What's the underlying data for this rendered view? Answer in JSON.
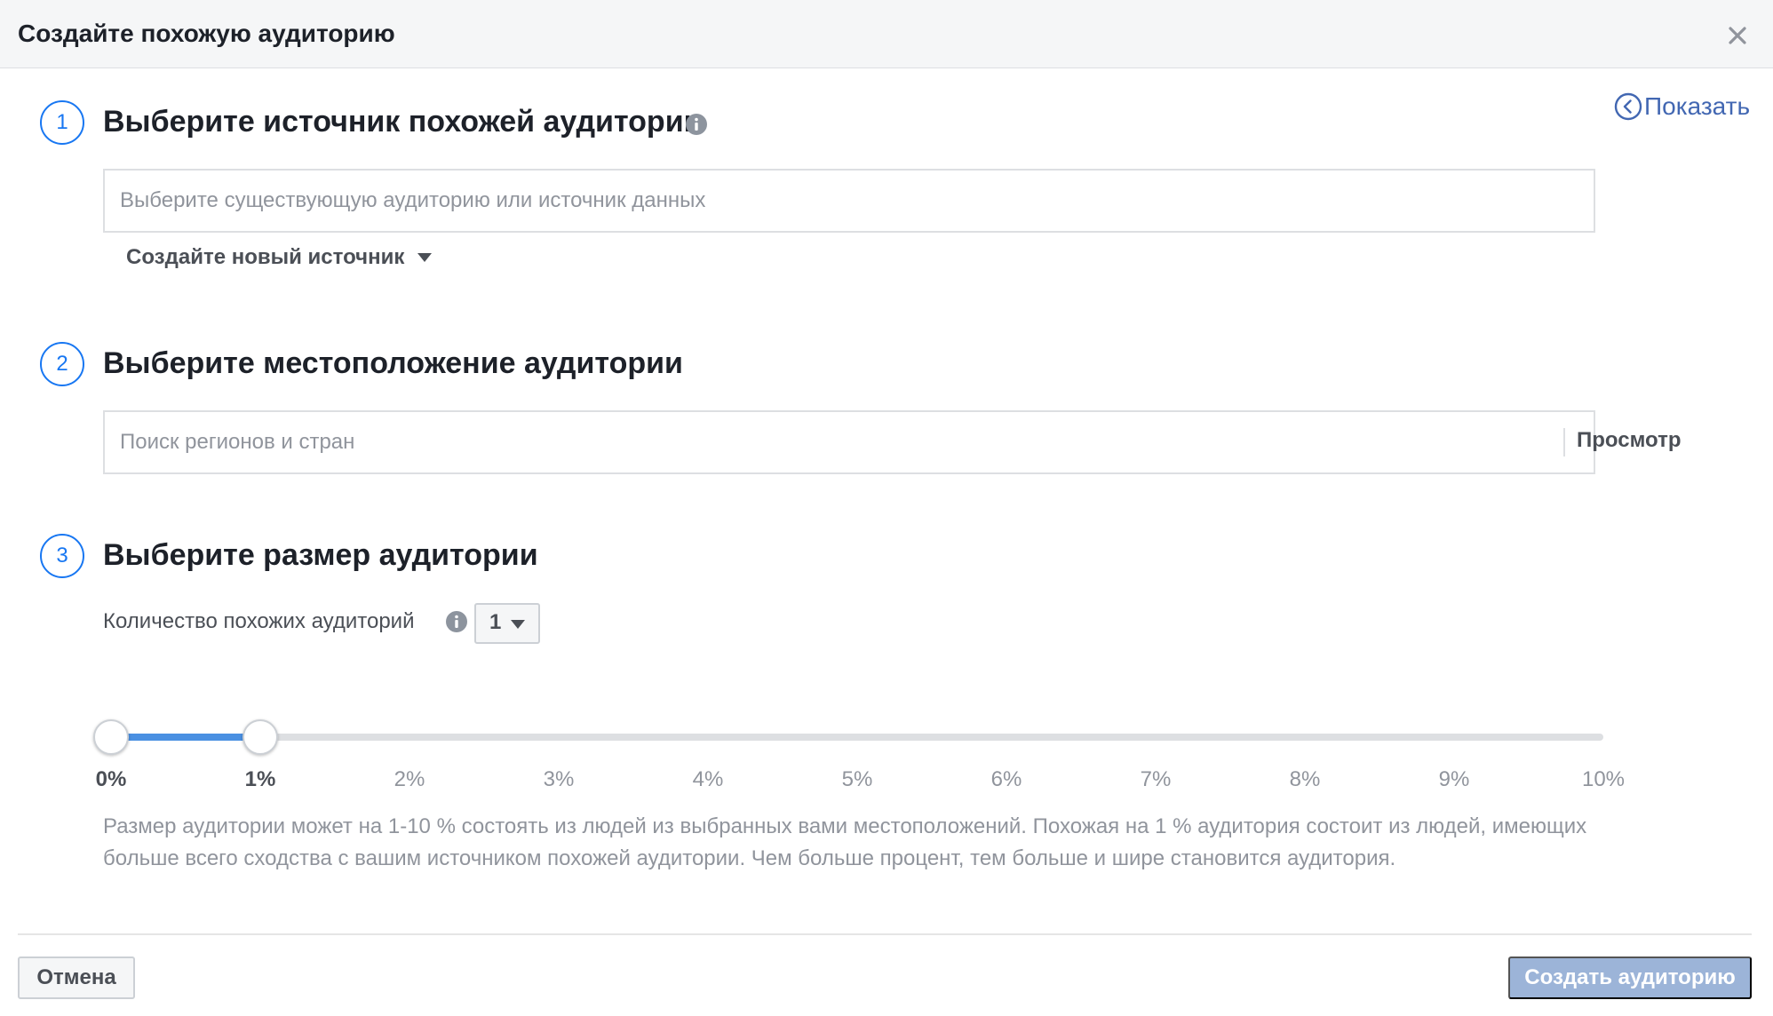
{
  "dialog": {
    "title": "Создайте похожую аудиторию",
    "show_link": "Показать"
  },
  "step1": {
    "number": "1",
    "title": "Выберите источник похожей аудитории",
    "source_placeholder": "Выберите существующую аудиторию или источник данных",
    "new_source_label": "Создайте новый источник"
  },
  "step2": {
    "number": "2",
    "title": "Выберите местоположение аудитории",
    "location_placeholder": "Поиск регионов и стран",
    "browse_label": "Просмотр"
  },
  "step3": {
    "number": "3",
    "title": "Выберите размер аудитории",
    "count_label": "Количество похожих аудиторий",
    "count_value": "1",
    "slider": {
      "range_start_percent": 0,
      "range_end_percent": 1,
      "ticks": [
        "0%",
        "1%",
        "2%",
        "3%",
        "4%",
        "5%",
        "6%",
        "7%",
        "8%",
        "9%",
        "10%"
      ]
    },
    "description": "Размер аудитории может на 1-10 % состоять из людей из выбранных вами местоположений. Похожая на 1 % аудитория состоит из людей, имеющих больше всего сходства с вашим источником похожей аудитории. Чем больше процент, тем больше и шире становится аудитория."
  },
  "footer": {
    "cancel_label": "Отмена",
    "create_label": "Создать аудиторию"
  },
  "colors": {
    "accent": "#1877f2",
    "link": "#4267b2",
    "slider_fill": "#4a90e2",
    "create_button_disabled": "#9cb4d8"
  },
  "icons": {
    "close": "close-icon",
    "show": "chevron-left-circle-icon",
    "info": "info-icon",
    "caret": "caret-down-icon"
  }
}
